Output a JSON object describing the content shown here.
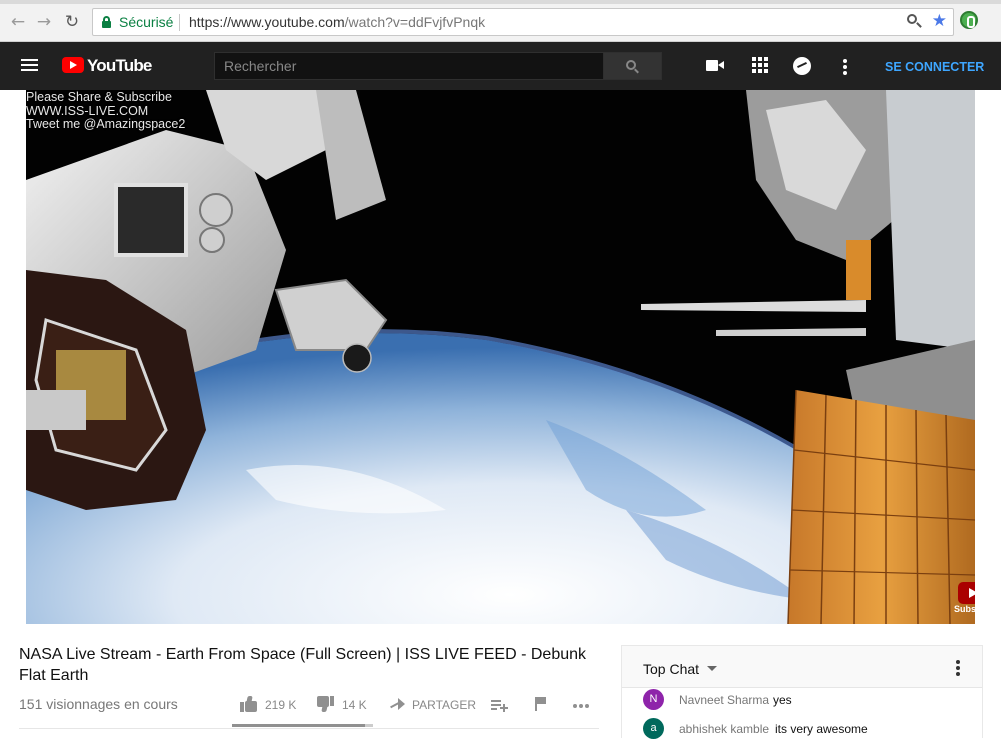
{
  "browser": {
    "secure_label": "Sécurisé",
    "url_host": "https://www.youtube.com",
    "url_path": "/watch?v=ddFvjfvPnqk"
  },
  "header": {
    "logo_text": "YouTube",
    "search_placeholder": "Rechercher",
    "signin_label": "SE CONNECTER"
  },
  "video": {
    "overlay_lines": [
      "Please Share & Subscribe",
      "WWW.ISS-LIVE.COM",
      "Tweet me @Amazingspace2"
    ],
    "subscribe_label": "Subscribe"
  },
  "info": {
    "title": "NASA Live Stream - Earth From Space (Full Screen) | ISS LIVE FEED - Debunk Flat Earth",
    "views": "151 visionnages en cours",
    "likes": "219 K",
    "dislikes": "14 K",
    "share_label": "PARTAGER",
    "like_ratio": 0.94
  },
  "chat": {
    "title": "Top Chat",
    "messages": [
      {
        "initial": "N",
        "author": "Navneet Sharma",
        "text": "yes",
        "color": "#8e24aa"
      },
      {
        "initial": "a",
        "author": "abhishek kamble",
        "text": "its very awesome",
        "color": "#00695c"
      }
    ]
  },
  "colors": {
    "accent_red": "#ff0000",
    "link_blue": "#3ea6ff",
    "secure_green": "#0b8043"
  }
}
